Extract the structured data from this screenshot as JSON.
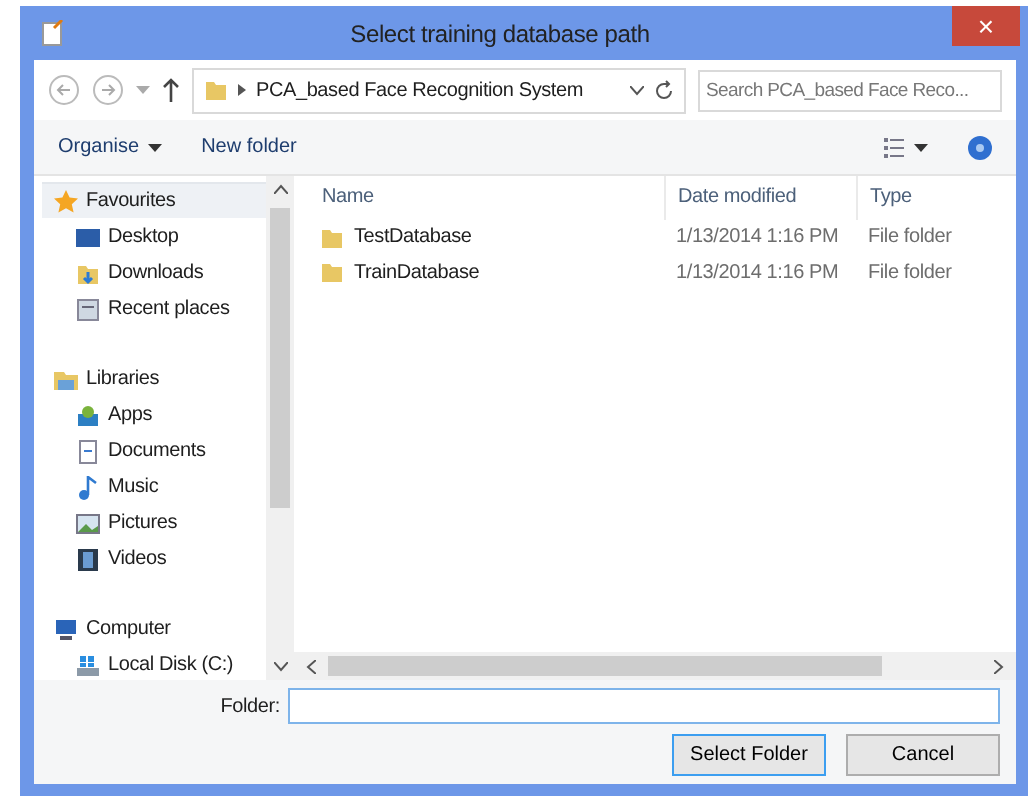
{
  "window": {
    "title": "Select training database path",
    "close": "×"
  },
  "address": {
    "path": "PCA_based Face Recognition System"
  },
  "search": {
    "placeholder": "Search PCA_based Face Reco..."
  },
  "toolbar": {
    "items": [
      {
        "label": "Organise",
        "kind": "menu"
      },
      {
        "label": "New folder",
        "kind": "button"
      }
    ]
  },
  "sidebar": {
    "groups": [
      {
        "label": "Favourites",
        "kind": "star",
        "selected": true,
        "children": [
          {
            "label": "Desktop",
            "kind": "desktop",
            "selected": false
          },
          {
            "label": "Downloads",
            "kind": "downloads",
            "selected": false
          },
          {
            "label": "Recent places",
            "kind": "recent",
            "selected": false
          }
        ]
      },
      {
        "label": "Libraries",
        "kind": "libraries",
        "selected": false,
        "children": [
          {
            "label": "Apps",
            "kind": "apps",
            "selected": false
          },
          {
            "label": "Documents",
            "kind": "documents",
            "selected": false
          },
          {
            "label": "Music",
            "kind": "music",
            "selected": false
          },
          {
            "label": "Pictures",
            "kind": "pictures",
            "selected": false
          },
          {
            "label": "Videos",
            "kind": "videos",
            "selected": false
          }
        ]
      },
      {
        "label": "Computer",
        "kind": "computer",
        "selected": false,
        "children": [
          {
            "label": "Local Disk (C:)",
            "kind": "disk",
            "selected": false
          }
        ]
      }
    ]
  },
  "table": {
    "columns": [
      "Name",
      "Date modified",
      "Type"
    ],
    "rows": [
      {
        "name": "TestDatabase",
        "date": "1/13/2014 1:16 PM",
        "type": "File folder"
      },
      {
        "name": "TrainDatabase",
        "date": "1/13/2014 1:16 PM",
        "type": "File folder"
      }
    ]
  },
  "folder_field": {
    "label": "Folder:"
  },
  "buttons": [
    {
      "label": "Select Folder",
      "kind": "default"
    },
    {
      "label": "Cancel",
      "kind": "normal"
    }
  ]
}
